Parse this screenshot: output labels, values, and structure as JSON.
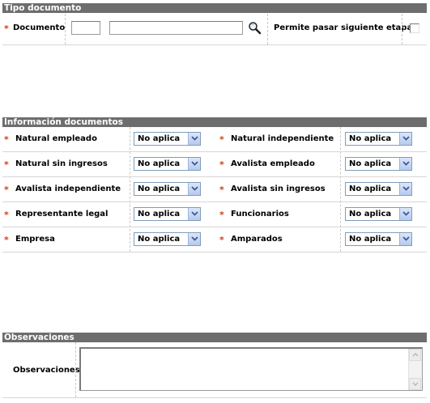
{
  "tipo": {
    "header": "Tipo documento",
    "documento_label": "Documento",
    "permite_label": "Permite pasar siguiente etapa",
    "required_mark": "*"
  },
  "info": {
    "header": "Información documentos",
    "required_mark": "*",
    "left": [
      {
        "label": "Natural empleado",
        "value": "No aplica"
      },
      {
        "label": "Natural sin ingresos",
        "value": "No aplica"
      },
      {
        "label": "Avalista independiente",
        "value": "No aplica"
      },
      {
        "label": "Representante legal",
        "value": "No aplica"
      },
      {
        "label": "Empresa",
        "value": "No aplica"
      }
    ],
    "right": [
      {
        "label": "Natural independiente",
        "value": "No aplica"
      },
      {
        "label": "Avalista empleado",
        "value": "No aplica"
      },
      {
        "label": "Avalista sin ingresos",
        "value": "No aplica"
      },
      {
        "label": "Funcionarios",
        "value": "No aplica"
      },
      {
        "label": "Amparados",
        "value": "No aplica"
      }
    ]
  },
  "obs": {
    "header": "Observaciones",
    "label": "Observaciones"
  },
  "icons": {
    "search": "magnifier-icon",
    "dropdown": "chevron-down-icon"
  },
  "colors": {
    "header_bg": "#6d6d6d",
    "required": "#d04010",
    "select_border": "#7f9db9"
  }
}
